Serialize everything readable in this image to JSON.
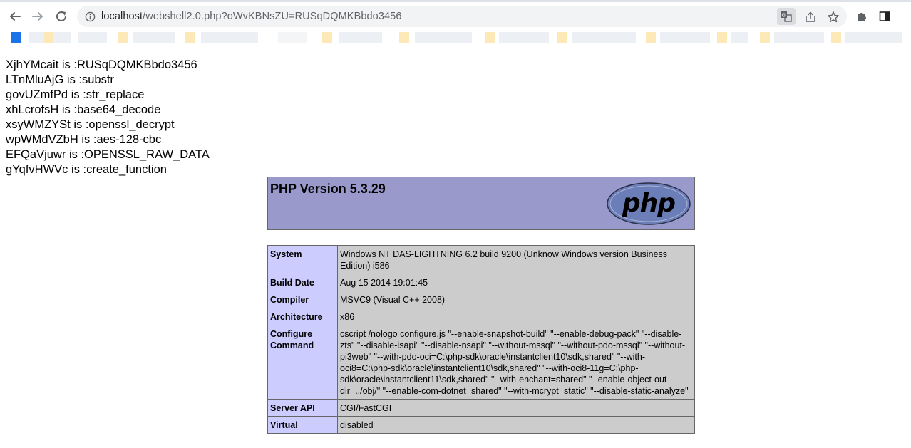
{
  "browser": {
    "url_host": "localhost",
    "url_path": "/webshell2.0.php?oWvKBNsZU=RUSqDQMKBbdo3456"
  },
  "variables": [
    {
      "name": "XjhYMcait",
      "value": "RUSqDQMKBbdo3456"
    },
    {
      "name": "LTnMluAjG",
      "value": "substr"
    },
    {
      "name": "govUZmfPd",
      "value": "str_replace"
    },
    {
      "name": "xhLcrofsH",
      "value": "base64_decode"
    },
    {
      "name": "xsyWMZYSt",
      "value": "openssl_decrypt"
    },
    {
      "name": "wpWMdVZbH",
      "value": "aes-128-cbc"
    },
    {
      "name": "EFQaVjuwr",
      "value": "OPENSSL_RAW_DATA"
    },
    {
      "name": "gYqfvHWVc",
      "value": "create_function"
    }
  ],
  "variable_separator": " is :",
  "phpinfo": {
    "title": "PHP Version 5.3.29",
    "logo_text": "php",
    "rows": [
      {
        "key": "System",
        "value": "Windows NT DAS-LIGHTNING 6.2 build 9200 (Unknow Windows version Business Edition) i586"
      },
      {
        "key": "Build Date",
        "value": "Aug 15 2014 19:01:45"
      },
      {
        "key": "Compiler",
        "value": "MSVC9 (Visual C++ 2008)"
      },
      {
        "key": "Architecture",
        "value": "x86"
      },
      {
        "key": "Configure Command",
        "value": "cscript /nologo configure.js \"--enable-snapshot-build\" \"--enable-debug-pack\" \"--disable-zts\" \"--disable-isapi\" \"--disable-nsapi\" \"--without-mssql\" \"--without-pdo-mssql\" \"--without-pi3web\" \"--with-pdo-oci=C:\\php-sdk\\oracle\\instantclient10\\sdk,shared\" \"--with-oci8=C:\\php-sdk\\oracle\\instantclient10\\sdk,shared\" \"--with-oci8-11g=C:\\php-sdk\\oracle\\instantclient11\\sdk,shared\" \"--with-enchant=shared\" \"--enable-object-out-dir=../obj/\" \"--enable-com-dotnet=shared\" \"--with-mcrypt=static\" \"--disable-static-analyze\""
      },
      {
        "key": "Server API",
        "value": "CGI/FastCGI"
      },
      {
        "key": "Virtual",
        "value": "disabled"
      }
    ]
  },
  "colors": {
    "header_bg": "#9999cc",
    "key_bg": "#ccccff",
    "value_bg": "#cccccc"
  }
}
